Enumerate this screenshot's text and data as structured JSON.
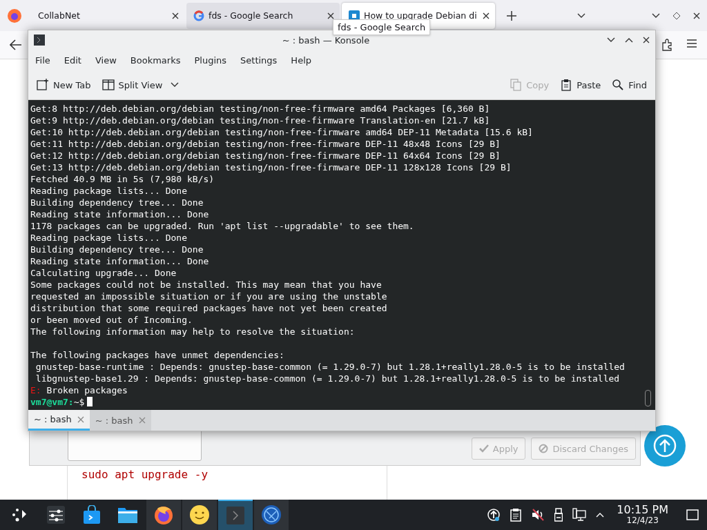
{
  "browser": {
    "tabs": [
      {
        "title": "CollabNet",
        "selected": false,
        "hovered": false,
        "kind": "plain"
      },
      {
        "title": "fds - Google Search",
        "selected": false,
        "hovered": true,
        "kind": "google"
      },
      {
        "title": "How to upgrade Debian di",
        "selected": true,
        "hovered": false,
        "kind": "site"
      }
    ],
    "tooltip": "fds - Google Search",
    "page": {
      "buttons": [
        {
          "label": "Apply",
          "kind": "apply",
          "disabled": true
        },
        {
          "label": "Discard Changes",
          "kind": "discard",
          "disabled": true
        }
      ],
      "code": "sudo apt upgrade -y"
    }
  },
  "konsole": {
    "title": "~ : bash — Konsole",
    "menu": [
      "File",
      "Edit",
      "View",
      "Bookmarks",
      "Plugins",
      "Settings",
      "Help"
    ],
    "toolbar": [
      {
        "label": "New Tab",
        "kind": "new-tab",
        "disabled": false
      },
      {
        "label": "Split View",
        "kind": "split-view",
        "disabled": false
      },
      {
        "label": "Copy",
        "kind": "copy",
        "disabled": true
      },
      {
        "label": "Paste",
        "kind": "paste",
        "disabled": false
      },
      {
        "label": "Find",
        "kind": "find",
        "disabled": false
      }
    ],
    "terminal": {
      "blocks": [
        {
          "lines": [
            "Get:8 http://deb.debian.org/debian testing/non-free-firmware amd64 Packages [6,360 B]",
            "Get:9 http://deb.debian.org/debian testing/non-free-firmware Translation-en [21.7 kB]",
            "Get:10 http://deb.debian.org/debian testing/non-free-firmware amd64 DEP-11 Metadata [15.6 kB]",
            "Get:11 http://deb.debian.org/debian testing/non-free-firmware DEP-11 48x48 Icons [29 B]",
            "Get:12 http://deb.debian.org/debian testing/non-free-firmware DEP-11 64x64 Icons [29 B]",
            "Get:13 http://deb.debian.org/debian testing/non-free-firmware DEP-11 128x128 Icons [29 B]",
            "Fetched 40.9 MB in 5s (7,980 kB/s)",
            "Reading package lists... Done",
            "Building dependency tree... Done",
            "Reading state information... Done",
            "1178 packages can be upgraded. Run 'apt list --upgradable' to see them.",
            "Reading package lists... Done",
            "Building dependency tree... Done",
            "Reading state information... Done",
            "Calculating upgrade... Done",
            "Some packages could not be installed. This may mean that you have",
            "requested an impossible situation or if you are using the unstable",
            "distribution that some required packages have not yet been created",
            "or been moved out of Incoming.",
            "The following information may help to resolve the situation:"
          ]
        },
        {
          "lines": [
            "The following packages have unmet dependencies:",
            " gnustep-base-runtime : Depends: gnustep-base-common (= 1.29.0-7) but 1.28.1+really1.28.0-5 is to be installed",
            " libgnustep-base1.29 : Depends: gnustep-base-common (= 1.29.0-7) but 1.28.1+really1.28.0-5 is to be installed"
          ]
        }
      ],
      "error": {
        "label": "E:",
        "text": "Broken packages"
      },
      "prompt": {
        "user": "vm7@vm7:",
        "path": "~$"
      }
    },
    "tabs": [
      {
        "label": "~ : bash",
        "selected": true
      },
      {
        "label": "~ : bash",
        "selected": false
      }
    ]
  },
  "taskbar": {
    "apps": [
      {
        "kind": "launcher",
        "running": false,
        "active": false
      },
      {
        "kind": "settings",
        "running": false,
        "active": false
      },
      {
        "kind": "store",
        "running": false,
        "active": false
      },
      {
        "kind": "files",
        "running": false,
        "active": false
      },
      {
        "kind": "firefox",
        "running": true,
        "active": false
      },
      {
        "kind": "smiley",
        "running": true,
        "active": false
      },
      {
        "kind": "terminal",
        "running": true,
        "active": true
      },
      {
        "kind": "globe",
        "running": true,
        "active": false
      }
    ],
    "clock": {
      "time": "10:15 PM",
      "date": "12/4/23"
    }
  }
}
